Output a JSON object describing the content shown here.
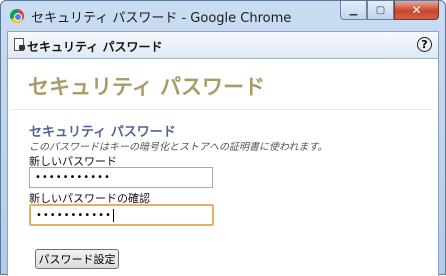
{
  "window": {
    "title": "セキュリティ パスワード - Google Chrome",
    "minimize_label": "▁",
    "maximize_label": "▢",
    "close_label": "✕"
  },
  "toolbar": {
    "title": "セキュリティ パスワード",
    "help_label": "?"
  },
  "page": {
    "heading": "セキュリティ パスワード",
    "section_title": "セキュリティ パスワード",
    "section_description": "このパスワードはキーの暗号化とストアへの証明書に使われます。",
    "new_password_label": "新しいパスワード",
    "new_password_value": "•••••••••••",
    "confirm_password_label": "新しいパスワードの確認",
    "confirm_password_value": "•••••••••••",
    "set_button_label": "パスワード設定"
  },
  "colors": {
    "heading": "#a89b68",
    "section_title": "#50629a",
    "focus_border": "#e3b062"
  }
}
